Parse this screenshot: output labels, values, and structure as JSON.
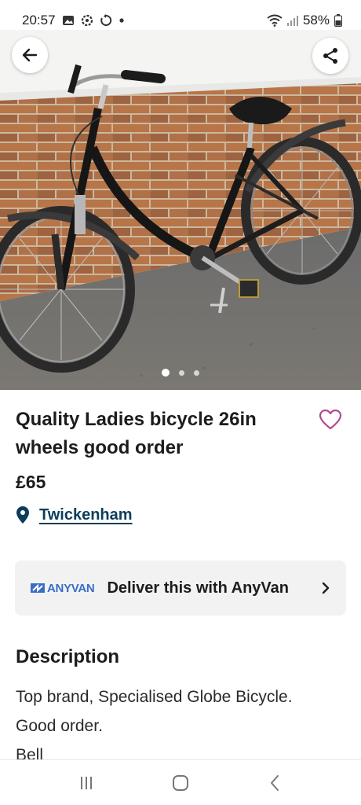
{
  "status_bar": {
    "time": "20:57",
    "battery": "58%",
    "icons": [
      "image-notification-icon",
      "settings-notification-icon",
      "sync-icon",
      "dot-icon",
      "wifi-icon",
      "signal-icon",
      "battery-icon"
    ]
  },
  "hero": {
    "back_icon": "arrow-left-icon",
    "share_icon": "share-icon",
    "image_count": 3,
    "active_image": 1
  },
  "listing": {
    "title": "Quality Ladies bicycle 26in wheels good order",
    "price": "£65",
    "location": "Twickenham"
  },
  "anyvan": {
    "logo": "ANYVAN",
    "label": "Deliver this with AnyVan"
  },
  "description": {
    "heading": "Description",
    "lines": [
      "Top brand, Specialised Globe Bicycle.",
      "Good order.",
      "Bell"
    ]
  },
  "colors": {
    "accent": "#0c3d5a",
    "heart": "#b14a8f",
    "anyvan_blue": "#3a6ec6",
    "card_bg": "#f2f2f2"
  },
  "navbar": {
    "items": [
      "recent-apps-icon",
      "home-icon",
      "back-icon"
    ]
  }
}
